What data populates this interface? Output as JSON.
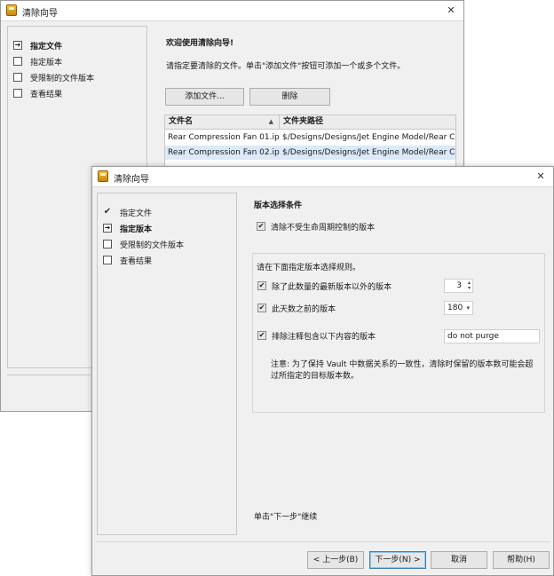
{
  "back_window": {
    "title": "清除向导",
    "nav": [
      "指定文件",
      "指定版本",
      "受限制的文件版本",
      "查看结果"
    ],
    "welcome": "欢迎使用清除向导!",
    "instruction": "请指定要清除的文件。单击\"添加文件\"按钮可添加一个或多个文件。",
    "add_button": "添加文件...",
    "delete_button": "删除",
    "columns": [
      "文件名",
      "文件夹路径"
    ],
    "rows": [
      {
        "name": "Rear Compression Fan 01.ipt",
        "path": "$/Designs/Designs/Jet Engine Model/Rear Co..."
      },
      {
        "name": "Rear Compression Fan 02.ipt",
        "path": "$/Designs/Designs/Jet Engine Model/Rear Co..."
      }
    ]
  },
  "front_window": {
    "title": "清除向导",
    "nav": [
      "指定文件",
      "指定版本",
      "受限制的文件版本",
      "查看结果"
    ],
    "section_title": "版本选择条件",
    "purge_uncontrolled": "清除不受生命周期控制的版本",
    "rules_heading": "请在下面指定版本选择规则。",
    "rule_keep_latest": "除了此数量的最新版本以外的版本",
    "rule_keep_latest_value": "3",
    "rule_older_days": "此天数之前的版本",
    "rule_older_days_value": "180",
    "rule_exclude_comment": "排除注释包含以下内容的版本",
    "rule_exclude_comment_value": "do not purge",
    "note": "注意: 为了保持 Vault 中数据关系的一致性，清除时保留的版本数可能会超过所指定的目标版本数。",
    "footer_hint": "单击\"下一步\"继续",
    "buttons": {
      "back": "< 上一步(B)",
      "next": "下一步(N) >",
      "cancel": "取消",
      "help": "帮助(H)"
    }
  }
}
